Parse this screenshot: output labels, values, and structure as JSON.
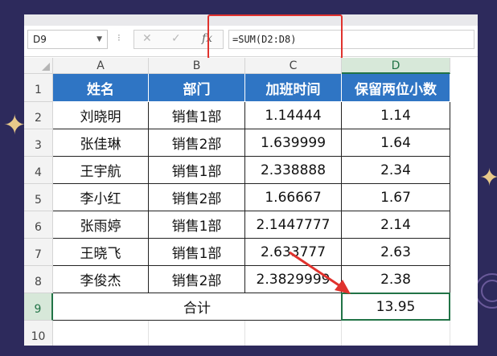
{
  "formula_bar": {
    "name_box": "D9",
    "formula": "=SUM(D2:D8)",
    "cancel_icon": "✕",
    "enter_icon": "✓",
    "fx_icon": "fx"
  },
  "columns": [
    "A",
    "B",
    "C",
    "D"
  ],
  "rows": [
    "1",
    "2",
    "3",
    "4",
    "5",
    "6",
    "7",
    "8",
    "9",
    "10"
  ],
  "table": {
    "headers": [
      "姓名",
      "部门",
      "加班时间",
      "保留两位小数"
    ],
    "rows": [
      [
        "刘晓明",
        "销售1部",
        "1.14444",
        "1.14"
      ],
      [
        "张佳琳",
        "销售2部",
        "1.639999",
        "1.64"
      ],
      [
        "王宇航",
        "销售1部",
        "2.338888",
        "2.34"
      ],
      [
        "李小红",
        "销售2部",
        "1.66667",
        "1.67"
      ],
      [
        "张雨婷",
        "销售1部",
        "2.1447777",
        "2.14"
      ],
      [
        "王晓飞",
        "销售1部",
        "2.633777",
        "2.63"
      ],
      [
        "李俊杰",
        "销售2部",
        "2.3829999",
        "2.38"
      ]
    ],
    "total_label": "合计",
    "total_value": "13.95"
  },
  "colors": {
    "header_bg": "#2f75c4",
    "selection": "#217346",
    "highlight": "#e0322d"
  }
}
